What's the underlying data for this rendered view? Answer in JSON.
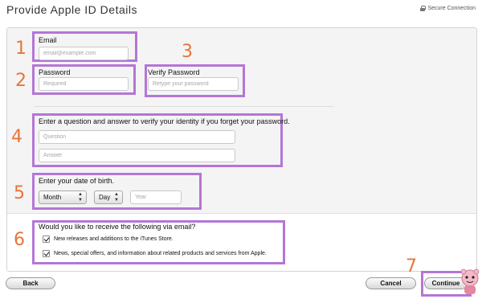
{
  "header": {
    "title": "Provide Apple ID Details",
    "secure_label": "Secure Connection"
  },
  "steps": [
    "1",
    "2",
    "3",
    "4",
    "5",
    "6",
    "7"
  ],
  "email": {
    "label": "Email",
    "placeholder": "email@example.com"
  },
  "password": {
    "label": "Password",
    "placeholder": "Required"
  },
  "verify_password": {
    "label": "Verify Password",
    "placeholder": "Retype your password"
  },
  "security": {
    "label": "Enter a question and answer to verify your identity if you forget your password.",
    "question_placeholder": "Question",
    "answer_placeholder": "Answer"
  },
  "birth": {
    "label": "Enter your date of birth.",
    "month": "Month",
    "day": "Day",
    "year_placeholder": "Year"
  },
  "email_prefs": {
    "label": "Would you like to receive the following via email?",
    "options": [
      {
        "label": "New releases and additions to the iTunes Store.",
        "checked": true
      },
      {
        "label": "News, special offers, and information about related products and services from Apple.",
        "checked": true
      }
    ]
  },
  "buttons": {
    "back": "Back",
    "cancel": "Cancel",
    "continue": "Continue"
  },
  "colors": {
    "highlight": "#b476d6",
    "step_number": "#e8743b"
  }
}
